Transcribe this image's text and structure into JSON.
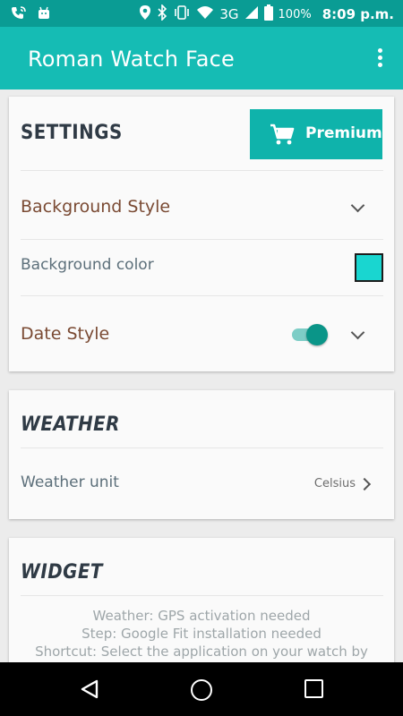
{
  "status_bar": {
    "network": "3G",
    "battery": "100%",
    "time": "8:09 p.m."
  },
  "app_bar": {
    "title": "Roman Watch Face",
    "overflow_icon": "more-vert-icon"
  },
  "settings": {
    "heading": "SETTINGS",
    "premium_label": "Premium",
    "premium_icon": "cart-icon",
    "background_style_label": "Background Style",
    "background_color_label": "Background color",
    "background_color_value": "#19d6d0",
    "date_style_label": "Date Style",
    "date_style_enabled": true
  },
  "weather": {
    "heading": "WEATHER",
    "unit_label": "Weather unit",
    "unit_value": "Celsius"
  },
  "widget": {
    "heading": "WIDGET",
    "info_lines": [
      "Weather: GPS activation needed",
      "Step: Google Fit installation needed",
      "Shortcut: Select the application on your watch by"
    ]
  },
  "nav_bar": {
    "back_icon": "back-icon",
    "home_icon": "home-icon",
    "recents_icon": "recents-icon"
  },
  "colors": {
    "status_bar": "#0a9c94",
    "app_bar": "#15bcb4",
    "premium": "#0fb3ab",
    "toggle_on": "#0a9588"
  }
}
